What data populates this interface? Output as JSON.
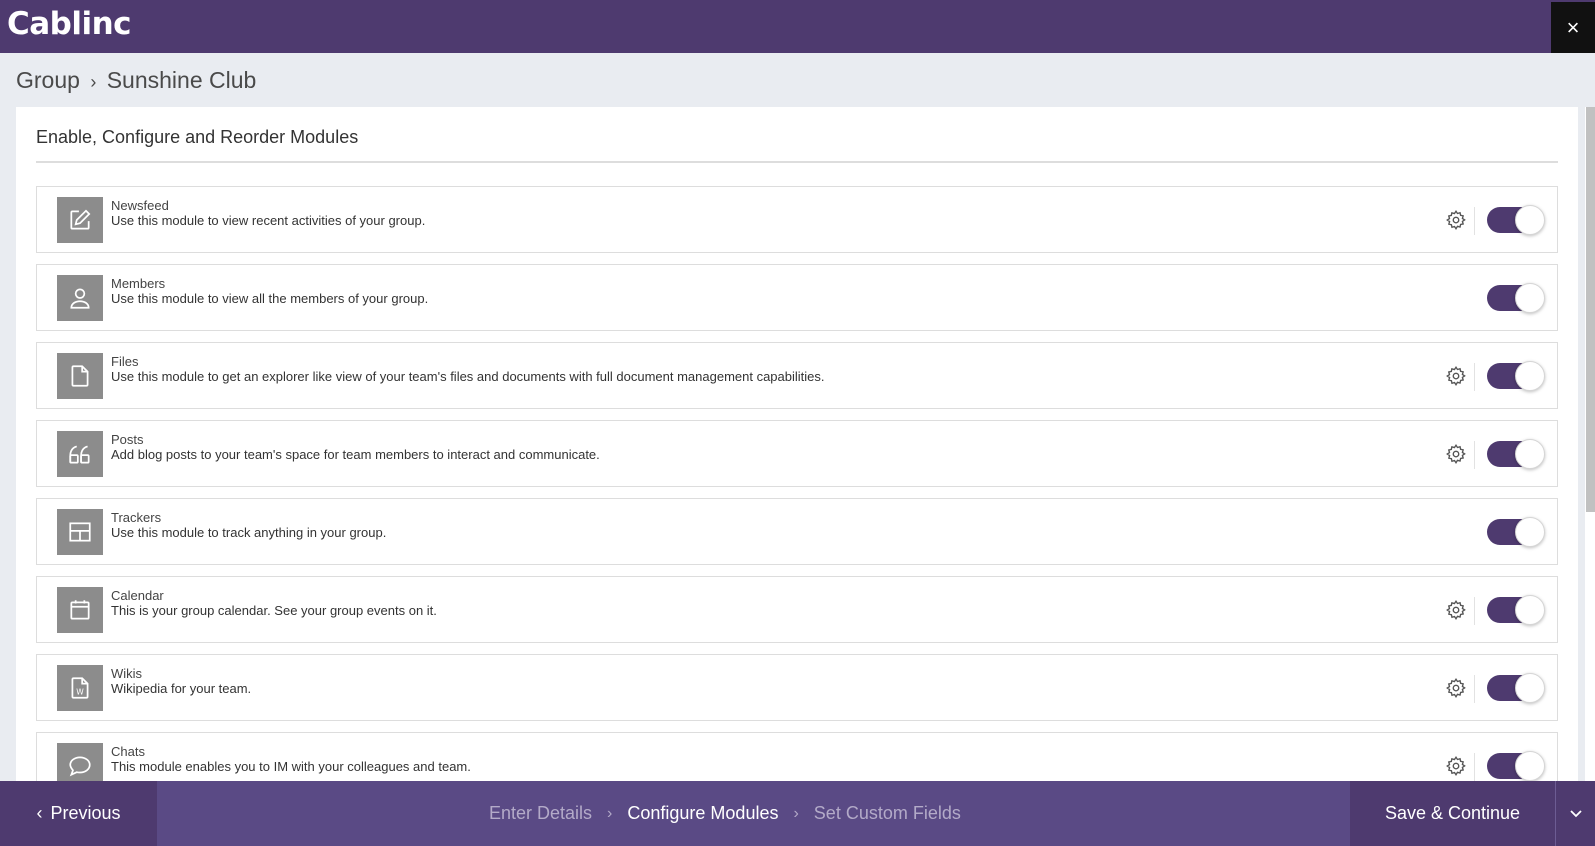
{
  "app": {
    "logo": "Cablinc",
    "close_icon": "×"
  },
  "breadcrumb": {
    "parent": "Group",
    "separator": "›",
    "current": "Sunshine Club"
  },
  "panel": {
    "title": "Enable, Configure and Reorder Modules"
  },
  "modules": [
    {
      "name": "Newsfeed",
      "description": "Use this module to view recent activities of your group.",
      "icon": "edit-icon",
      "has_settings": true,
      "enabled": true
    },
    {
      "name": "Members",
      "description": "Use this module to view all the members of your group.",
      "icon": "user-icon",
      "has_settings": false,
      "enabled": true
    },
    {
      "name": "Files",
      "description": "Use this module to get an explorer like view of your team's files and documents with full document management capabilities.",
      "icon": "file-icon",
      "has_settings": true,
      "enabled": true
    },
    {
      "name": "Posts",
      "description": "Add blog posts to your team's space for team members to interact and communicate.",
      "icon": "quote-icon",
      "has_settings": true,
      "enabled": true
    },
    {
      "name": "Trackers",
      "description": "Use this module to track anything in your group.",
      "icon": "table-icon",
      "has_settings": false,
      "enabled": true
    },
    {
      "name": "Calendar",
      "description": "This is your group calendar. See your group events on it.",
      "icon": "calendar-icon",
      "has_settings": true,
      "enabled": true
    },
    {
      "name": "Wikis",
      "description": "Wikipedia for your team.",
      "icon": "wiki-icon",
      "has_settings": true,
      "enabled": true
    },
    {
      "name": "Chats",
      "description": "This module enables you to IM with your colleagues and team.",
      "icon": "chat-icon",
      "has_settings": true,
      "enabled": true
    }
  ],
  "footer": {
    "previous_label": "Previous",
    "steps": [
      {
        "label": "Enter Details",
        "active": false
      },
      {
        "label": "Configure Modules",
        "active": true
      },
      {
        "label": "Set Custom Fields",
        "active": false
      }
    ],
    "save_label": "Save & Continue"
  },
  "colors": {
    "brand": "#4e3a6f",
    "footer": "#5a4a85",
    "icon_bg": "#8c8c8c"
  }
}
